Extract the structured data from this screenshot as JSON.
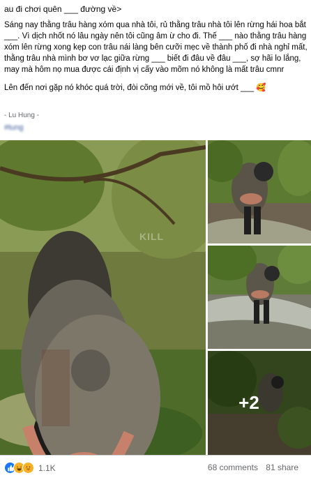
{
  "header": {
    "link_text": "au đi chơi quên ___ đường về>"
  },
  "post": {
    "paragraph_1": "Sáng nay thằng trâu hàng xóm qua nhà tôi, rủ thằng trâu nhà tôi lên rừng hái hoa bắt ___. Vì dịch nhốt nó lâu ngày nên tôi cũng âm ừ cho đi. Thế ___ nào thằng trâu hàng xóm lên rừng xong kẹp con trâu nái làng bên cưỡi mẹc về thành phố đi nhà nghỉ mất, thằng trâu nhà mình bơ vơ lạc giữa rừng ___ biết đi đâu về đâu ___, sợ hãi lo lắng, may mà hôm nọ mua được cái định vị cấy vào mõm nó không là mất trâu cmnr",
    "paragraph_2": "Lên đến nơi gặp nó khóc quá trời, đòi cõng mới về, tôi mồ hôi ướt ___ 🥰",
    "signature": "- Lu Hung -",
    "hashtag": "#tung"
  },
  "photos": {
    "more_count": "+2",
    "watermark": "KILL"
  },
  "footer": {
    "reaction_count": "1.1K",
    "comments": "68 comments",
    "shares": "81 share"
  },
  "reaction_icons": [
    "like-icon",
    "haha-icon",
    "care-icon"
  ]
}
